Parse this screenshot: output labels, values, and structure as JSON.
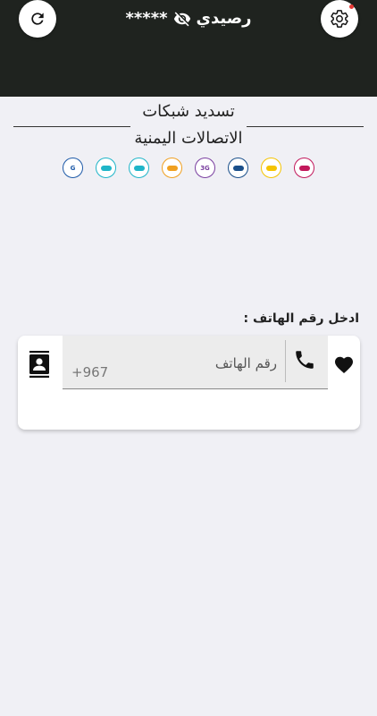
{
  "header": {
    "balance_label": "رصيدي",
    "balance_masked": "*****",
    "bg_color": "#1f231f"
  },
  "title": {
    "line1": "تسديد شبكات",
    "line2": "الاتصالات اليمنية"
  },
  "networks": [
    {
      "icon": "network-logo-1",
      "color": "#1e5aa8",
      "text": "G"
    },
    {
      "icon": "network-logo-2",
      "color": "#1fb5c8",
      "text": ""
    },
    {
      "icon": "network-logo-3",
      "color": "#1fb5c8",
      "text": ""
    },
    {
      "icon": "network-logo-4",
      "color": "#f0a020",
      "text": ""
    },
    {
      "icon": "network-logo-5",
      "color": "#7a3fa0",
      "text": "3G"
    },
    {
      "icon": "network-logo-6",
      "color": "#1a4f8a",
      "text": ""
    },
    {
      "icon": "network-logo-7",
      "color": "#f5c400",
      "text": ""
    },
    {
      "icon": "network-logo-8",
      "color": "#c2185b",
      "text": ""
    }
  ],
  "form": {
    "phone_label": "ادخل رقم الهاتف :",
    "phone_placeholder": "رقم الهاتف",
    "country_prefix": "+967"
  }
}
